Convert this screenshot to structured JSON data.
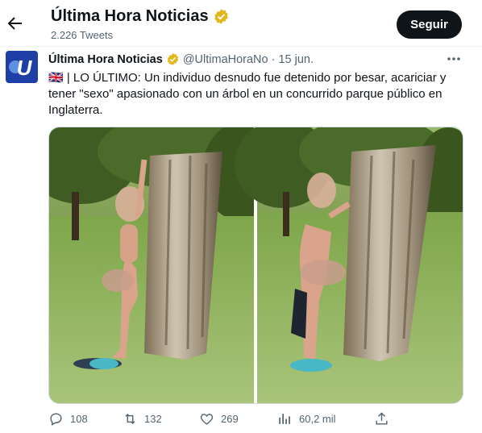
{
  "header": {
    "title": "Última Hora Noticias",
    "tweet_count": "2.226 Tweets",
    "follow_label": "Seguir"
  },
  "tweet": {
    "author_name": "Última Hora Noticias",
    "handle": "@UltimaHoraNo",
    "separator": "·",
    "date": "15 jun.",
    "flag": "🇬🇧",
    "text": "| LO ÚLTIMO: Un individuo desnudo fue detenido por besar, acariciar y tener \"sexo\" apasionado con un árbol en un concurrido parque público en Inglaterra.",
    "avatar_letter": "U"
  },
  "actions": {
    "replies": "108",
    "retweets": "132",
    "likes": "269",
    "views": "60,2 mil"
  },
  "icons": {
    "back": "arrow-left-icon",
    "verified": "verified-badge-icon",
    "more": "more-dots-icon",
    "reply": "reply-icon",
    "retweet": "retweet-icon",
    "like": "heart-icon",
    "views": "views-icon",
    "share": "share-icon"
  },
  "colors": {
    "verified_gold": "#e2b719",
    "follow_bg": "#0f1419",
    "avatar_bg": "#1d3fa6"
  }
}
